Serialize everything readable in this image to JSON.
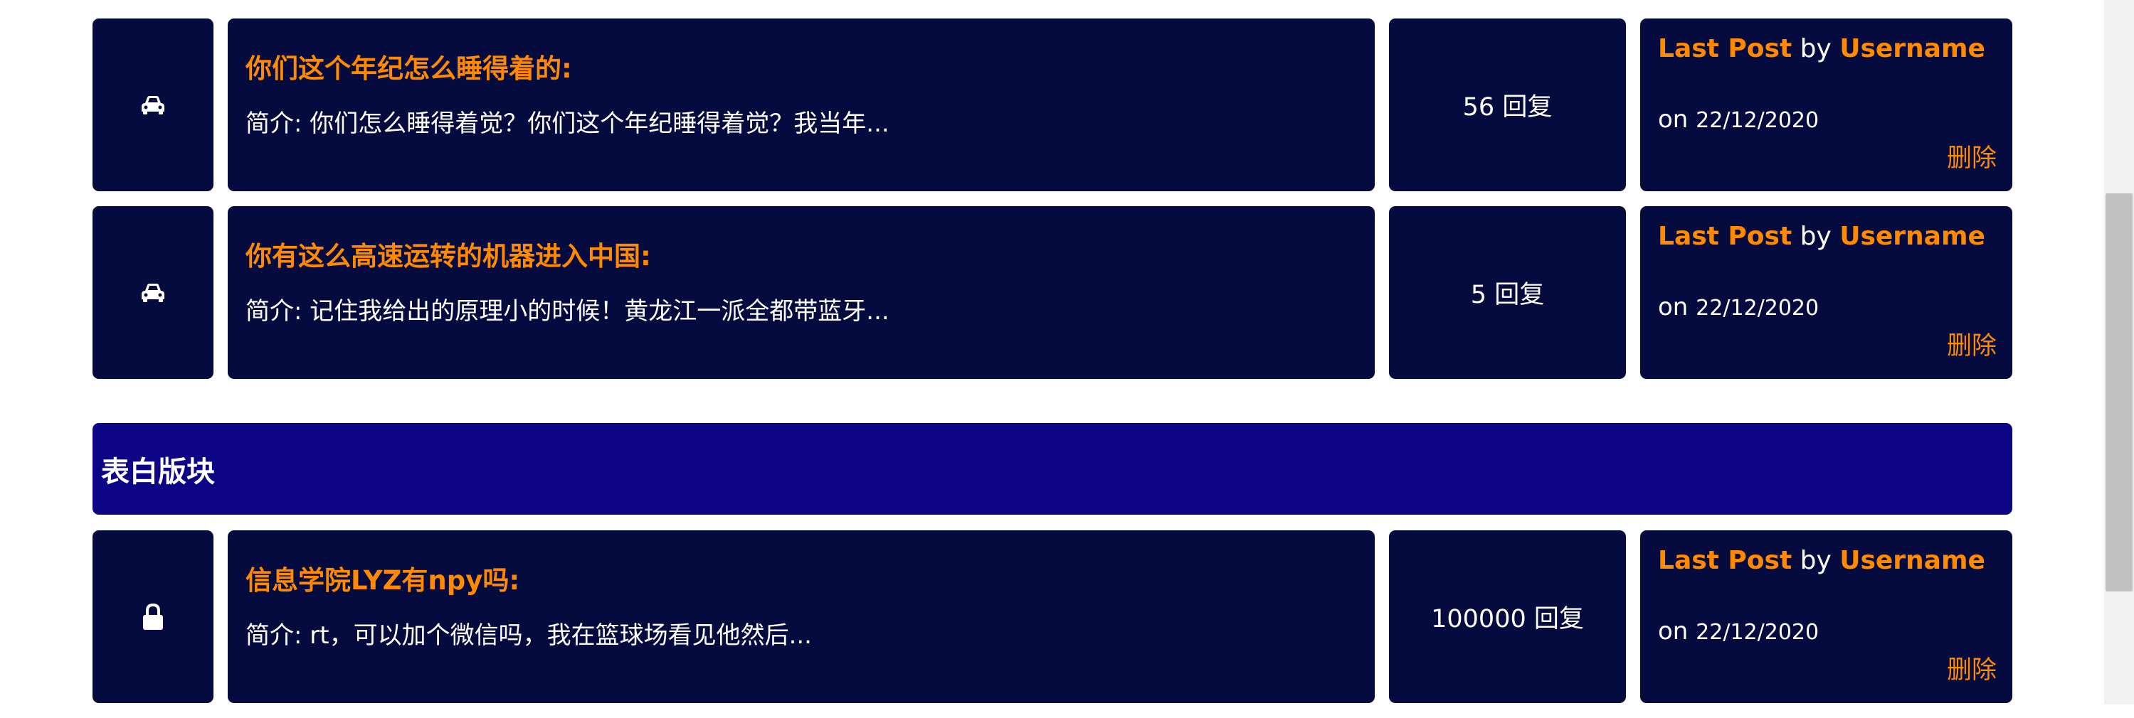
{
  "section": {
    "title": "表白版块"
  },
  "rows": [
    {
      "icon": "car-icon",
      "title": "你们这个年纪怎么睡得着的:",
      "desc": "简介: 你们怎么睡得着觉？你们这个年纪睡得着觉？我当年...",
      "count": "56 回复",
      "last_post": {
        "label": "Last Post",
        "by": "by",
        "user": "Username",
        "on": "on",
        "date": "22/12/2020",
        "delete": "删除"
      }
    },
    {
      "icon": "car-icon",
      "title": "你有这么高速运转的机器进入中国:",
      "desc": "简介: 记住我给出的原理小的时候！黄龙江一派全都带蓝牙...",
      "count": "5 回复",
      "last_post": {
        "label": "Last Post",
        "by": "by",
        "user": "Username",
        "on": "on",
        "date": "22/12/2020",
        "delete": "删除"
      }
    },
    {
      "icon": "lock-icon",
      "title": "信息学院LYZ有npy吗:",
      "desc": "简介: rt，可以加个微信吗，我在篮球场看见他然后...",
      "count": "100000 回复",
      "last_post": {
        "label": "Last Post",
        "by": "by",
        "user": "Username",
        "on": "on",
        "date": "22/12/2020",
        "delete": "删除"
      }
    }
  ],
  "colors": {
    "cell_bg": "#060b3f",
    "header_bg": "#0d0585",
    "accent": "#ff8a00",
    "text": "#ffffff"
  }
}
